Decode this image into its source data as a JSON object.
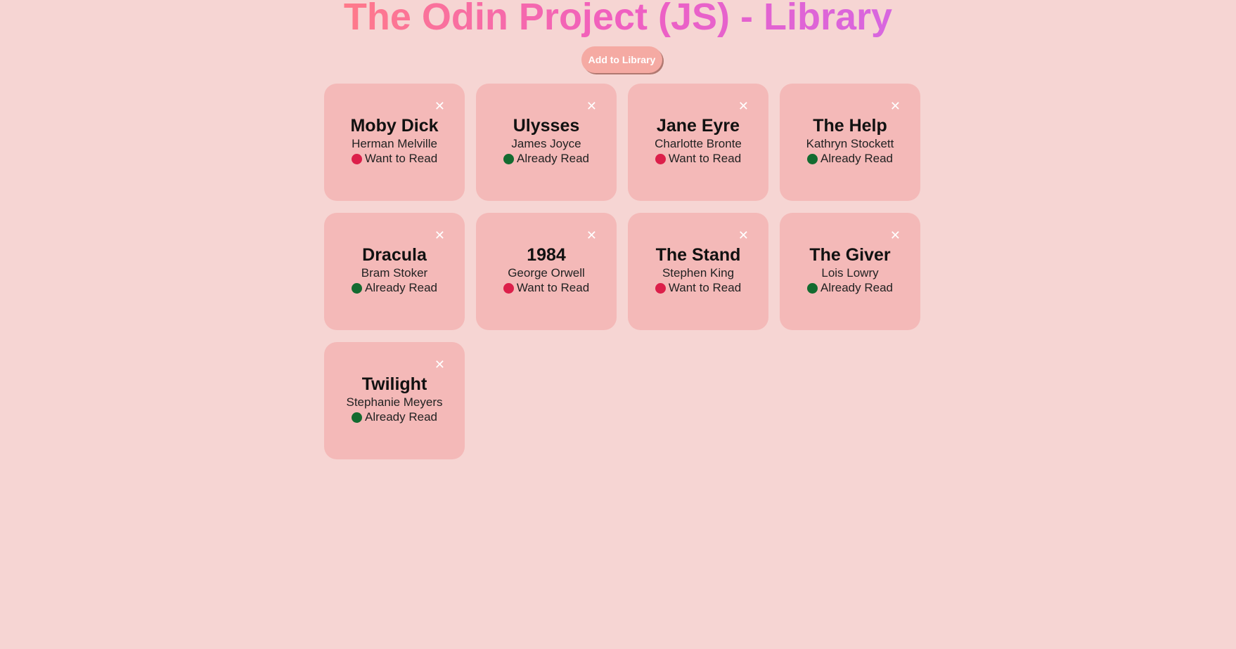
{
  "header": {
    "title": "The Odin Project (JS) - Library",
    "add_button": "Add to Library"
  },
  "colors": {
    "want": "#dc1f4a",
    "read": "#136b30"
  },
  "books": [
    {
      "title": "Moby Dick",
      "author": "Herman Melville",
      "status": "Want to Read",
      "read": false
    },
    {
      "title": "Ulysses",
      "author": "James Joyce",
      "status": "Already Read",
      "read": true
    },
    {
      "title": "Jane Eyre",
      "author": "Charlotte Bronte",
      "status": "Want to Read",
      "read": false
    },
    {
      "title": "The Help",
      "author": "Kathryn Stockett",
      "status": "Already Read",
      "read": true
    },
    {
      "title": "Dracula",
      "author": "Bram Stoker",
      "status": "Already Read",
      "read": true
    },
    {
      "title": "1984",
      "author": "George Orwell",
      "status": "Want to Read",
      "read": false
    },
    {
      "title": "The Stand",
      "author": "Stephen King",
      "status": "Want to Read",
      "read": false
    },
    {
      "title": "The Giver",
      "author": "Lois Lowry",
      "status": "Already Read",
      "read": true
    },
    {
      "title": "Twilight",
      "author": "Stephanie Meyers",
      "status": "Already Read",
      "read": true
    }
  ],
  "close_glyph": "✕"
}
